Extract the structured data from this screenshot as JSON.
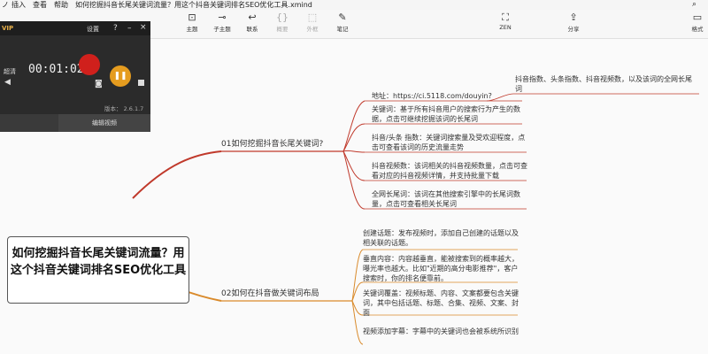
{
  "menubar": {
    "m1": "ノ",
    "insert": "插入",
    "view": "查看",
    "help": "帮助",
    "doc_title": "如何挖掘抖音长尾关键词流量？用这个抖音关键词排名SEO优化工具.xmind"
  },
  "toolbar": {
    "topic": "主题",
    "subtopic": "子主题",
    "link": "联系",
    "boundary": "概要",
    "outline": "外框",
    "note": "笔记",
    "zen": "ZEN",
    "share": "分享",
    "format": "格式"
  },
  "recorder": {
    "vip": "VIP",
    "settings": "设置",
    "help": "?",
    "quality": "超清",
    "time": "00:01:02",
    "version": "版本： 2.6.1.7",
    "edit_video": "编辑视频"
  },
  "mindmap": {
    "central": "如何挖掘抖音长尾关键词流量？用这个抖音关键词排名SEO优化工具",
    "branch1": {
      "title": "01如何挖掘抖音长尾关键词?",
      "top_note": "抖音指数、头条指数、抖音视频数，以及该词的全网长尾词",
      "items": [
        "地址：https://ci.5118.com/douyin?",
        "关键词：基于所有抖音用户的搜索行为产生的数据，点击可继续挖掘该词的长尾词",
        "抖音/头条 指数：关键词搜索量及受欢迎程度，点击可查看该词的历史流量走势",
        "抖音视频数：该词相关的抖音视频数量，点击可查看对应的抖音视频详情，并支持批量下载",
        "全网长尾词：该词在其他搜索引擎中的长尾词数量，点击可查看相关长尾词"
      ]
    },
    "branch2": {
      "title": "02如何在抖音做关键词布局",
      "items": [
        "创建话题：发布视频时，添加自己创建的话题以及相关联的话题。",
        "垂直内容：内容越垂直，能被搜索到的概率越大，曝光率也越大。比如\"近期的高分电影推荐\"，客户搜索时，你的排名便靠前。",
        "关键词覆盖：视频标题、内容、文案都要包含关键词，其中包括话题、标题、合集、视频、文案、封面",
        "视频添加字幕：字幕中的关键词也会被系统所识别"
      ]
    }
  },
  "colors": {
    "branch": "#c8701c",
    "line_branch1": "#c0392b",
    "line_branch2": "#d98a2b",
    "record": "#d0201c"
  }
}
